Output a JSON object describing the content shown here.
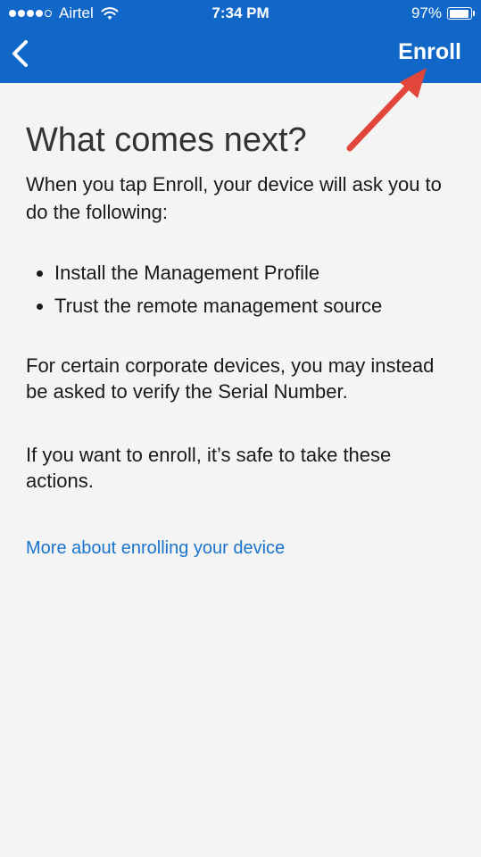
{
  "status_bar": {
    "carrier": "Airtel",
    "time": "7:34 PM",
    "battery": "97%",
    "battery_fraction": 0.97,
    "signal_bars_filled": 4,
    "signal_bars_total": 5,
    "wifi_icon": "wifi-icon",
    "battery_icon": "battery-icon"
  },
  "nav": {
    "back_icon": "chevron-left-icon",
    "enroll_label": "Enroll",
    "bar_color": "#1167c7"
  },
  "annotation": {
    "arrow_color": "#e2453a"
  },
  "content": {
    "title": "What comes next?",
    "intro": "When you tap Enroll, your device will ask you to do the following:",
    "steps": [
      "Install the Management Profile",
      "Trust the remote management source"
    ],
    "corporate_note": "For certain corporate devices, you may instead be asked to verify the Serial Number.",
    "safe_note": "If you want to enroll, it’s safe to take these actions.",
    "more_link": "More about enrolling your device"
  }
}
